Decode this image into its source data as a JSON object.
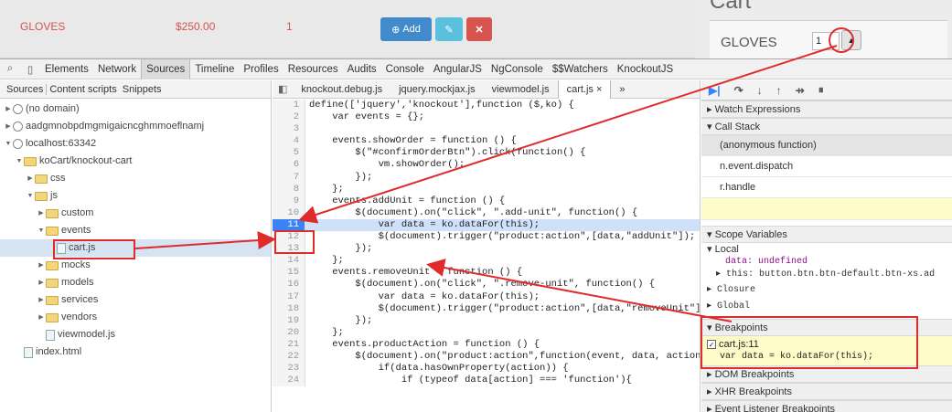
{
  "app": {
    "product_name": "GLOVES",
    "product_price": "$250.00",
    "product_qty": "1",
    "add_label": "Add",
    "cart_title": "Cart",
    "cart_item_name": "GLOVES",
    "cart_qty": "1"
  },
  "devtools": {
    "main_tabs": [
      "Elements",
      "Network",
      "Sources",
      "Timeline",
      "Profiles",
      "Resources",
      "Audits",
      "Console",
      "AngularJS",
      "NgConsole",
      "$$Watchers",
      "KnockoutJS"
    ],
    "active_main_tab": "Sources",
    "left_tabs": [
      "Sources",
      "Content scripts",
      "Snippets"
    ],
    "tree": [
      {
        "label": "(no domain)",
        "kind": "globe",
        "depth": 0
      },
      {
        "label": "aadgmnobpdmgmigaicncghmmoeflnamj",
        "kind": "globe",
        "depth": 0
      },
      {
        "label": "localhost:63342",
        "kind": "globe",
        "depth": 0
      },
      {
        "label": "koCart/knockout-cart",
        "kind": "folder",
        "depth": 1
      },
      {
        "label": "css",
        "kind": "folder",
        "depth": 2
      },
      {
        "label": "js",
        "kind": "folder",
        "depth": 2
      },
      {
        "label": "custom",
        "kind": "folder",
        "depth": 3
      },
      {
        "label": "events",
        "kind": "folder",
        "depth": 3
      },
      {
        "label": "cart.js",
        "kind": "file",
        "depth": 4
      },
      {
        "label": "mocks",
        "kind": "folder",
        "depth": 3
      },
      {
        "label": "models",
        "kind": "folder",
        "depth": 3
      },
      {
        "label": "services",
        "kind": "folder",
        "depth": 3
      },
      {
        "label": "vendors",
        "kind": "folder",
        "depth": 3
      },
      {
        "label": "viewmodel.js",
        "kind": "file",
        "depth": 3
      },
      {
        "label": "index.html",
        "kind": "file",
        "depth": 1
      }
    ],
    "file_tabs": [
      "knockout.debug.js",
      "jquery.mockjax.js",
      "viewmodel.js",
      "cart.js ×",
      "»"
    ],
    "active_file_tab": "cart.js ×",
    "code_lines": [
      {
        "n": "1",
        "text": "define(['jquery','knockout'],function ($,ko) {"
      },
      {
        "n": "2",
        "text": "    var events = {};"
      },
      {
        "n": "3",
        "text": ""
      },
      {
        "n": "4",
        "text": "    events.showOrder = function () {"
      },
      {
        "n": "5",
        "text": "        $(\"#confirmOrderBtn\").click(function() {"
      },
      {
        "n": "6",
        "text": "            vm.showOrder();"
      },
      {
        "n": "7",
        "text": "        });"
      },
      {
        "n": "8",
        "text": "    };"
      },
      {
        "n": "9",
        "text": "    events.addUnit = function () {"
      },
      {
        "n": "10",
        "text": "        $(document).on(\"click\", \".add-unit\", function() {"
      },
      {
        "n": "11",
        "text": "            var data = ko.dataFor(this);"
      },
      {
        "n": "12",
        "text": "            $(document).trigger(\"product:action\",[data,\"addUnit\"]);"
      },
      {
        "n": "13",
        "text": "        });"
      },
      {
        "n": "14",
        "text": "    };"
      },
      {
        "n": "15",
        "text": "    events.removeUnit = function () {"
      },
      {
        "n": "16",
        "text": "        $(document).on(\"click\", \".remove-unit\", function() {"
      },
      {
        "n": "17",
        "text": "            var data = ko.dataFor(this);"
      },
      {
        "n": "18",
        "text": "            $(document).trigger(\"product:action\",[data,\"removeUnit\"]);"
      },
      {
        "n": "19",
        "text": "        });"
      },
      {
        "n": "20",
        "text": "    };"
      },
      {
        "n": "21",
        "text": "    events.productAction = function () {"
      },
      {
        "n": "22",
        "text": "        $(document).on(\"product:action\",function(event, data, action) {"
      },
      {
        "n": "23",
        "text": "            if(data.hasOwnProperty(action)) {"
      },
      {
        "n": "24",
        "text": "                if (typeof data[action] === 'function'){"
      }
    ],
    "breakpoint_line": "11",
    "right": {
      "watch": "Watch Expressions",
      "call_stack": "Call Stack",
      "stack": [
        "(anonymous function)",
        "n.event.dispatch",
        "r.handle"
      ],
      "scope": "Scope Variables",
      "local": "Local",
      "local_data": "data: undefined",
      "local_this": "this: button.btn.btn-default.btn-xs.ad",
      "closure": "Closure",
      "global": "Global",
      "breakpoints": "Breakpoints",
      "bp_file": "cart.js:11",
      "bp_code": "var data = ko.dataFor(this);",
      "dom_bp": "DOM Breakpoints",
      "xhr_bp": "XHR Breakpoints",
      "event_bp": "Event Listener Breakpoints"
    }
  },
  "colors": {
    "annotation": "#e02b2b",
    "breakpoint": "#3b82f6",
    "highlight": "#cfe0fb"
  }
}
